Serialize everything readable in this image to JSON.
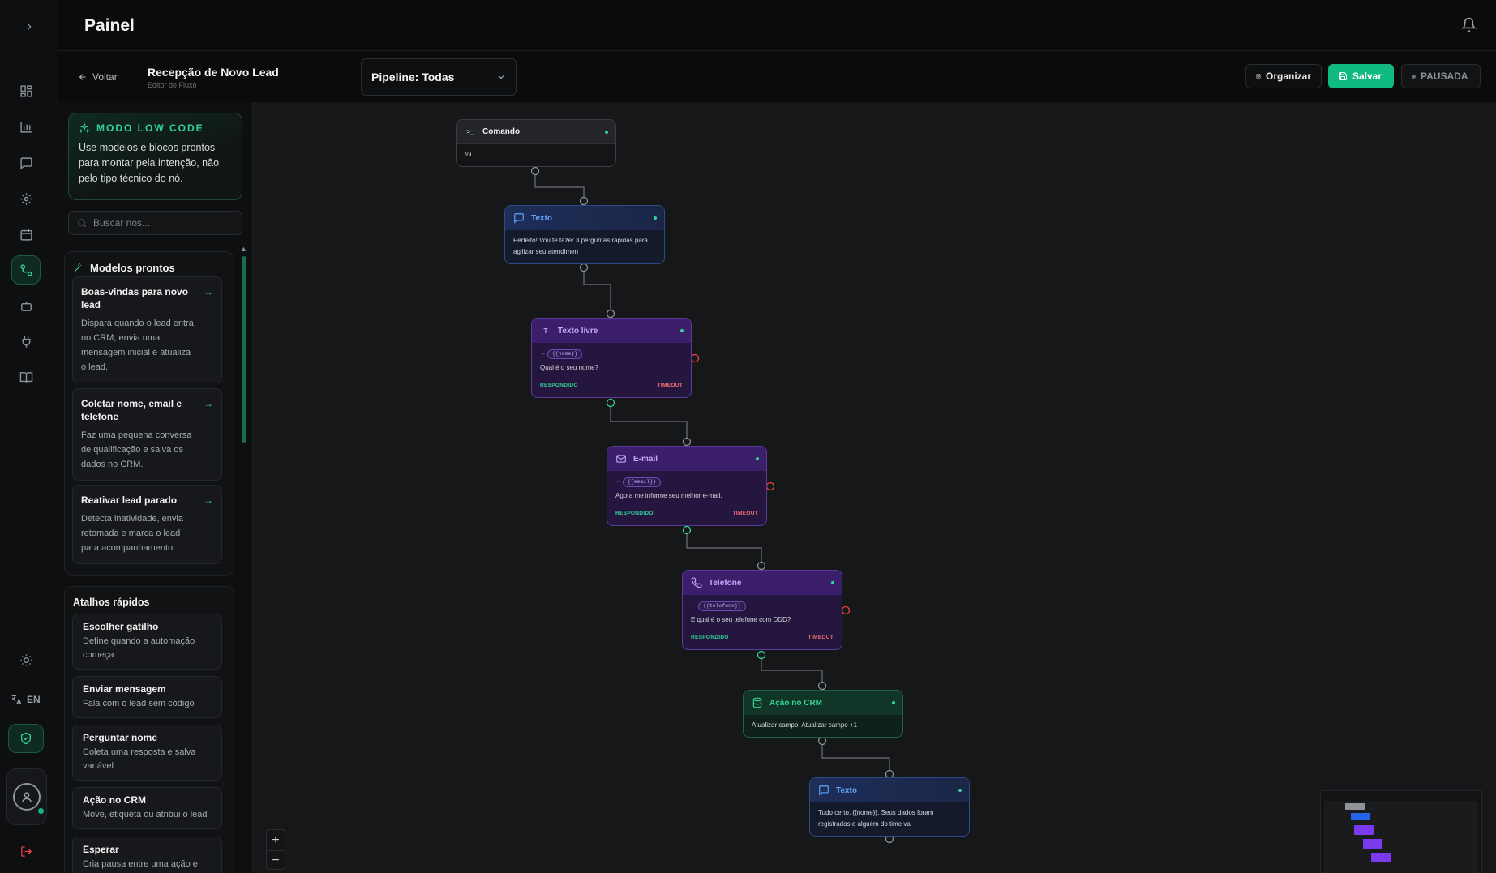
{
  "header": {
    "title": "Painel"
  },
  "subheader": {
    "back_label": "Voltar",
    "flow_title": "Recepção de Novo Lead",
    "flow_subtitle": "Editor de Fluxo",
    "pipeline_label": "Pipeline: Todas",
    "organize_label": "Organizar",
    "save_label": "Salvar",
    "status_label": "PAUSADA"
  },
  "rail": {
    "lang_label": "EN"
  },
  "panel": {
    "lowcode_title": "MODO LOW CODE",
    "lowcode_desc": "Use modelos e blocos prontos para montar pela intenção, não pelo tipo técnico do nó.",
    "search_placeholder": "Buscar nós...",
    "models_title": "Modelos prontos",
    "models": [
      {
        "title": "Boas-vindas para novo lead",
        "desc": "Dispara quando o lead entra no CRM, envia uma mensagem inicial e atualiza o lead."
      },
      {
        "title": "Coletar nome, email e telefone",
        "desc": "Faz uma pequena conversa de qualificação e salva os dados no CRM."
      },
      {
        "title": "Reativar lead parado",
        "desc": "Detecta inatividade, envia retomada e marca o lead para acompanhamento."
      }
    ],
    "shortcuts_title": "Atalhos rápidos",
    "shortcuts": [
      {
        "title": "Escolher gatilho",
        "desc": "Define quando a automação começa"
      },
      {
        "title": "Enviar mensagem",
        "desc": "Fala com o lead sem código"
      },
      {
        "title": "Perguntar nome",
        "desc": "Coleta uma resposta e salva variável"
      },
      {
        "title": "Ação no CRM",
        "desc": "Move, etiqueta ou atribui o lead"
      },
      {
        "title": "Esperar",
        "desc": "Cria pausa entre uma ação e"
      }
    ]
  },
  "nodes": {
    "command": {
      "title": "Comando",
      "body": "/oi"
    },
    "text1": {
      "title": "Texto",
      "body": "Perfeito! Vou te fazer 3 perguntas rápidas para agilizar seu atendimen"
    },
    "freetext": {
      "title": "Texto livre",
      "var": "{{nome}}",
      "body": "Qual é o seu nome?",
      "ok": "RESPONDIDO",
      "timeout": "TIMEOUT"
    },
    "email": {
      "title": "E-mail",
      "var": "{{email}}",
      "body": "Agora me informe seu melhor e-mail.",
      "ok": "RESPONDIDO",
      "timeout": "TIMEOUT"
    },
    "phone": {
      "title": "Telefone",
      "var": "{{telefone}}",
      "body": "E qual é o seu telefone com DDD?",
      "ok": "RESPONDIDO",
      "timeout": "TIMEOUT"
    },
    "crm": {
      "title": "Ação no CRM",
      "body": "Atualizar campo, Atualizar campo +1"
    },
    "text2": {
      "title": "Texto",
      "body": "Tudo certo, {{nome}}. Seus dados foram registrados e alguém do time va"
    }
  },
  "zoom": {
    "in": "+",
    "out": "−"
  },
  "colors": {
    "accent": "#10b981",
    "text_node": "#60a5fa",
    "question_node": "#7c3aed",
    "crm_node": "#34d399",
    "timeout": "#f87171"
  }
}
